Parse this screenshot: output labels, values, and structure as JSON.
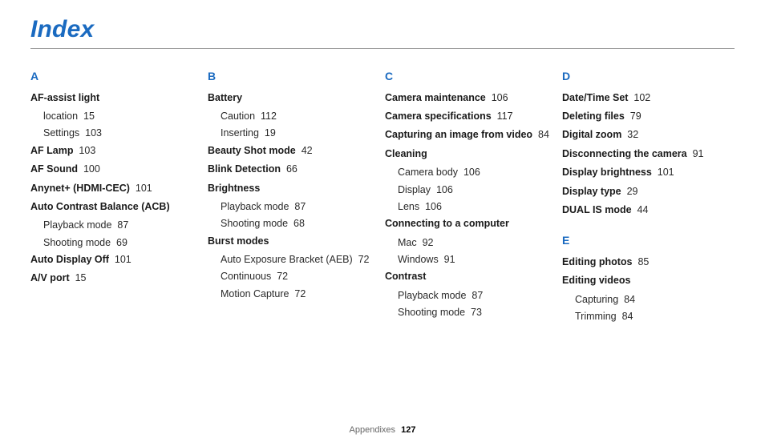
{
  "title": "Index",
  "footer": {
    "label": "Appendixes",
    "page": "127"
  },
  "columns": [
    {
      "sections": [
        {
          "letter": "A",
          "entries": [
            {
              "label": "AF-assist light",
              "page": "",
              "bold": true,
              "subs": [
                {
                  "label": "location",
                  "page": "15"
                },
                {
                  "label": "Settings",
                  "page": "103"
                }
              ]
            },
            {
              "label": "AF Lamp",
              "page": "103",
              "bold": true
            },
            {
              "label": "AF Sound",
              "page": "100",
              "bold": true
            },
            {
              "label": "Anynet+ (HDMI-CEC)",
              "page": "101",
              "bold": true
            },
            {
              "label": "Auto Contrast Balance (ACB)",
              "page": "",
              "bold": true,
              "subs": [
                {
                  "label": "Playback mode",
                  "page": "87"
                },
                {
                  "label": "Shooting mode",
                  "page": "69"
                }
              ]
            },
            {
              "label": "Auto Display Off",
              "page": "101",
              "bold": true
            },
            {
              "label": "A/V port",
              "page": "15",
              "bold": true
            }
          ]
        }
      ]
    },
    {
      "sections": [
        {
          "letter": "B",
          "entries": [
            {
              "label": "Battery",
              "page": "",
              "bold": true,
              "subs": [
                {
                  "label": "Caution",
                  "page": "112"
                },
                {
                  "label": "Inserting",
                  "page": "19"
                }
              ]
            },
            {
              "label": "Beauty Shot mode",
              "page": "42",
              "bold": true
            },
            {
              "label": "Blink Detection",
              "page": "66",
              "bold": true
            },
            {
              "label": "Brightness",
              "page": "",
              "bold": true,
              "subs": [
                {
                  "label": "Playback mode",
                  "page": "87"
                },
                {
                  "label": "Shooting mode",
                  "page": "68"
                }
              ]
            },
            {
              "label": "Burst modes",
              "page": "",
              "bold": true,
              "subs": [
                {
                  "label": "Auto Exposure Bracket (AEB)",
                  "page": "72"
                },
                {
                  "label": "Continuous",
                  "page": "72"
                },
                {
                  "label": "Motion Capture",
                  "page": "72"
                }
              ]
            }
          ]
        }
      ]
    },
    {
      "sections": [
        {
          "letter": "C",
          "entries": [
            {
              "label": "Camera maintenance",
              "page": "106",
              "bold": true
            },
            {
              "label": "Camera specifications",
              "page": "117",
              "bold": true
            },
            {
              "label": "Capturing an image from video",
              "page": "84",
              "bold": true
            },
            {
              "label": "Cleaning",
              "page": "",
              "bold": true,
              "subs": [
                {
                  "label": "Camera body",
                  "page": "106"
                },
                {
                  "label": "Display",
                  "page": "106"
                },
                {
                  "label": "Lens",
                  "page": "106"
                }
              ]
            },
            {
              "label": "Connecting to a computer",
              "page": "",
              "bold": true,
              "subs": [
                {
                  "label": "Mac",
                  "page": "92"
                },
                {
                  "label": "Windows",
                  "page": "91"
                }
              ]
            },
            {
              "label": "Contrast",
              "page": "",
              "bold": true,
              "subs": [
                {
                  "label": "Playback mode",
                  "page": "87"
                },
                {
                  "label": "Shooting mode",
                  "page": "73"
                }
              ]
            }
          ]
        }
      ]
    },
    {
      "sections": [
        {
          "letter": "D",
          "entries": [
            {
              "label": "Date/Time Set",
              "page": "102",
              "bold": true
            },
            {
              "label": "Deleting files",
              "page": "79",
              "bold": true
            },
            {
              "label": "Digital zoom",
              "page": "32",
              "bold": true
            },
            {
              "label": "Disconnecting the camera",
              "page": "91",
              "bold": true
            },
            {
              "label": "Display brightness",
              "page": "101",
              "bold": true
            },
            {
              "label": "Display type",
              "page": "29",
              "bold": true
            },
            {
              "label": "DUAL IS mode",
              "page": "44",
              "bold": true
            }
          ]
        },
        {
          "letter": "E",
          "entries": [
            {
              "label": "Editing photos",
              "page": "85",
              "bold": true
            },
            {
              "label": "Editing videos",
              "page": "",
              "bold": true,
              "subs": [
                {
                  "label": "Capturing",
                  "page": "84"
                },
                {
                  "label": "Trimming",
                  "page": "84"
                }
              ]
            }
          ]
        }
      ]
    }
  ]
}
